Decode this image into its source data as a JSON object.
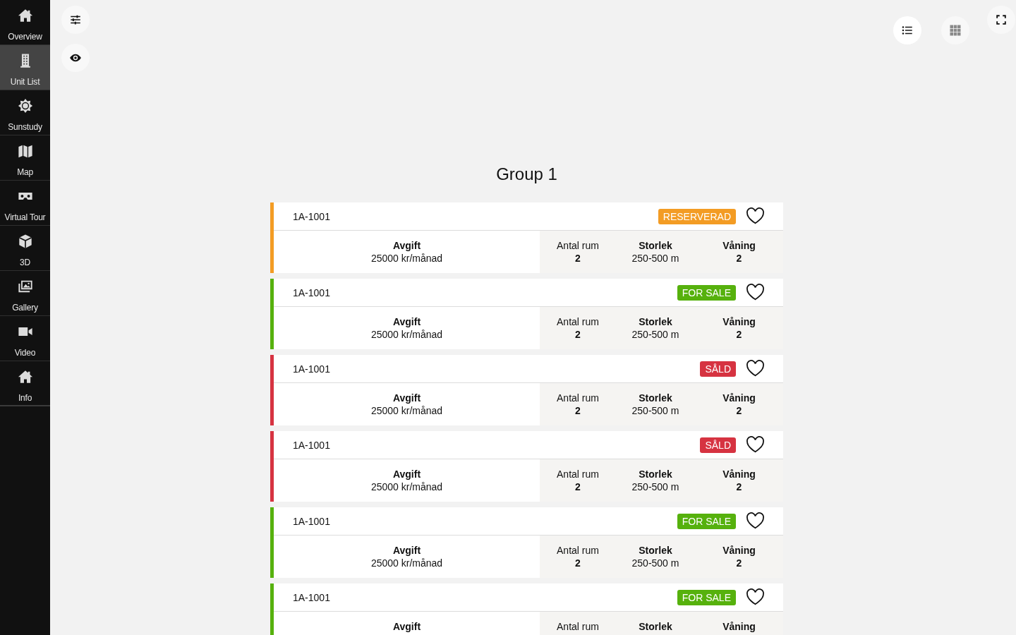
{
  "sidebar": {
    "items": [
      {
        "label": "Overview",
        "selected": false
      },
      {
        "label": "Unit List",
        "selected": true
      },
      {
        "label": "Sunstudy",
        "selected": false
      },
      {
        "label": "Map",
        "selected": false
      },
      {
        "label": "Virtual Tour",
        "selected": false
      },
      {
        "label": "3D",
        "selected": false
      },
      {
        "label": "Gallery",
        "selected": false
      },
      {
        "label": "Video",
        "selected": false
      },
      {
        "label": "Info",
        "selected": false
      }
    ]
  },
  "toolbar": {
    "view_buttons": [
      {
        "selected": true
      },
      {
        "selected": false
      }
    ]
  },
  "group": {
    "title": "Group 1",
    "units": [
      {
        "name": "1A-1001",
        "status": "RESERVERAD",
        "color": "#f39c24",
        "favorite": false,
        "fee": {
          "label": "Avgift",
          "value": "25000 kr/månad"
        },
        "details": [
          {
            "label": "Antal rum",
            "value": "2"
          },
          {
            "label": "Storlek",
            "value": "250-500 m"
          },
          {
            "label": "Våning",
            "value": "2"
          }
        ]
      },
      {
        "name": "1A-1001",
        "status": "FOR SALE",
        "color": "#56b10d",
        "favorite": false,
        "fee": {
          "label": "Avgift",
          "value": "25000 kr/månad"
        },
        "details": [
          {
            "label": "Antal rum",
            "value": "2"
          },
          {
            "label": "Storlek",
            "value": "250-500 m"
          },
          {
            "label": "Våning",
            "value": "2"
          }
        ]
      },
      {
        "name": "1A-1001",
        "status": "SÅLD",
        "color": "#d63341",
        "favorite": false,
        "fee": {
          "label": "Avgift",
          "value": "25000 kr/månad"
        },
        "details": [
          {
            "label": "Antal rum",
            "value": "2"
          },
          {
            "label": "Storlek",
            "value": "250-500 m"
          },
          {
            "label": "Våning",
            "value": "2"
          }
        ]
      },
      {
        "name": "1A-1001",
        "status": "SÅLD",
        "color": "#d63341",
        "favorite": false,
        "fee": {
          "label": "Avgift",
          "value": "25000 kr/månad"
        },
        "details": [
          {
            "label": "Antal rum",
            "value": "2"
          },
          {
            "label": "Storlek",
            "value": "250-500 m"
          },
          {
            "label": "Våning",
            "value": "2"
          }
        ]
      },
      {
        "name": "1A-1001",
        "status": "FOR SALE",
        "color": "#56b10d",
        "favorite": false,
        "fee": {
          "label": "Avgift",
          "value": "25000 kr/månad"
        },
        "details": [
          {
            "label": "Antal rum",
            "value": "2"
          },
          {
            "label": "Storlek",
            "value": "250-500 m"
          },
          {
            "label": "Våning",
            "value": "2"
          }
        ]
      },
      {
        "name": "1A-1001",
        "status": "FOR SALE",
        "color": "#56b10d",
        "favorite": false,
        "fee": {
          "label": "Avgift"
        },
        "details": [
          {
            "label": "Antal rum"
          },
          {
            "label": "Storlek"
          },
          {
            "label": "Våning"
          }
        ]
      }
    ]
  }
}
